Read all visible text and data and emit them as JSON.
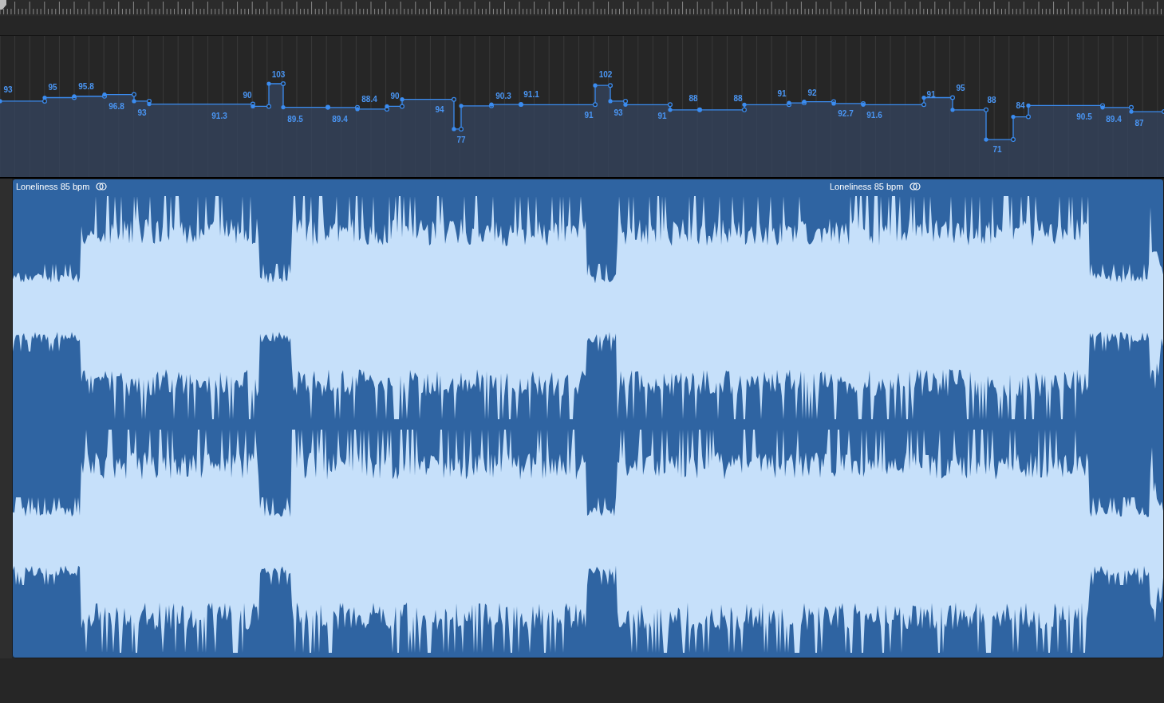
{
  "tempo_track": {
    "events": [
      {
        "tempo": "93"
      },
      {
        "tempo": "95"
      },
      {
        "tempo": "95.8"
      },
      {
        "tempo": "96.8"
      },
      {
        "tempo": "93"
      },
      {
        "tempo": "91.3"
      },
      {
        "tempo": "90"
      },
      {
        "tempo": "103"
      },
      {
        "tempo": "89.5"
      },
      {
        "tempo": "89.4"
      },
      {
        "tempo": "88.4"
      },
      {
        "tempo": "90"
      },
      {
        "tempo": "94"
      },
      {
        "tempo": "77"
      },
      {
        "tempo": "90.3"
      },
      {
        "tempo": "91.1"
      },
      {
        "tempo": "91"
      },
      {
        "tempo": "102"
      },
      {
        "tempo": "93"
      },
      {
        "tempo": "91"
      },
      {
        "tempo": "88"
      },
      {
        "tempo": "88"
      },
      {
        "tempo": "91"
      },
      {
        "tempo": "92"
      },
      {
        "tempo": "92.7"
      },
      {
        "tempo": "91.6"
      },
      {
        "tempo": "91"
      },
      {
        "tempo": "95"
      },
      {
        "tempo": "88"
      },
      {
        "tempo": "71"
      },
      {
        "tempo": "84"
      },
      {
        "tempo": "90.5"
      },
      {
        "tempo": "89.4"
      },
      {
        "tempo": "87"
      }
    ]
  },
  "region": {
    "labels": [
      {
        "name": "Loneliness 85 bpm"
      },
      {
        "name": "Loneliness 85 bpm"
      }
    ]
  }
}
